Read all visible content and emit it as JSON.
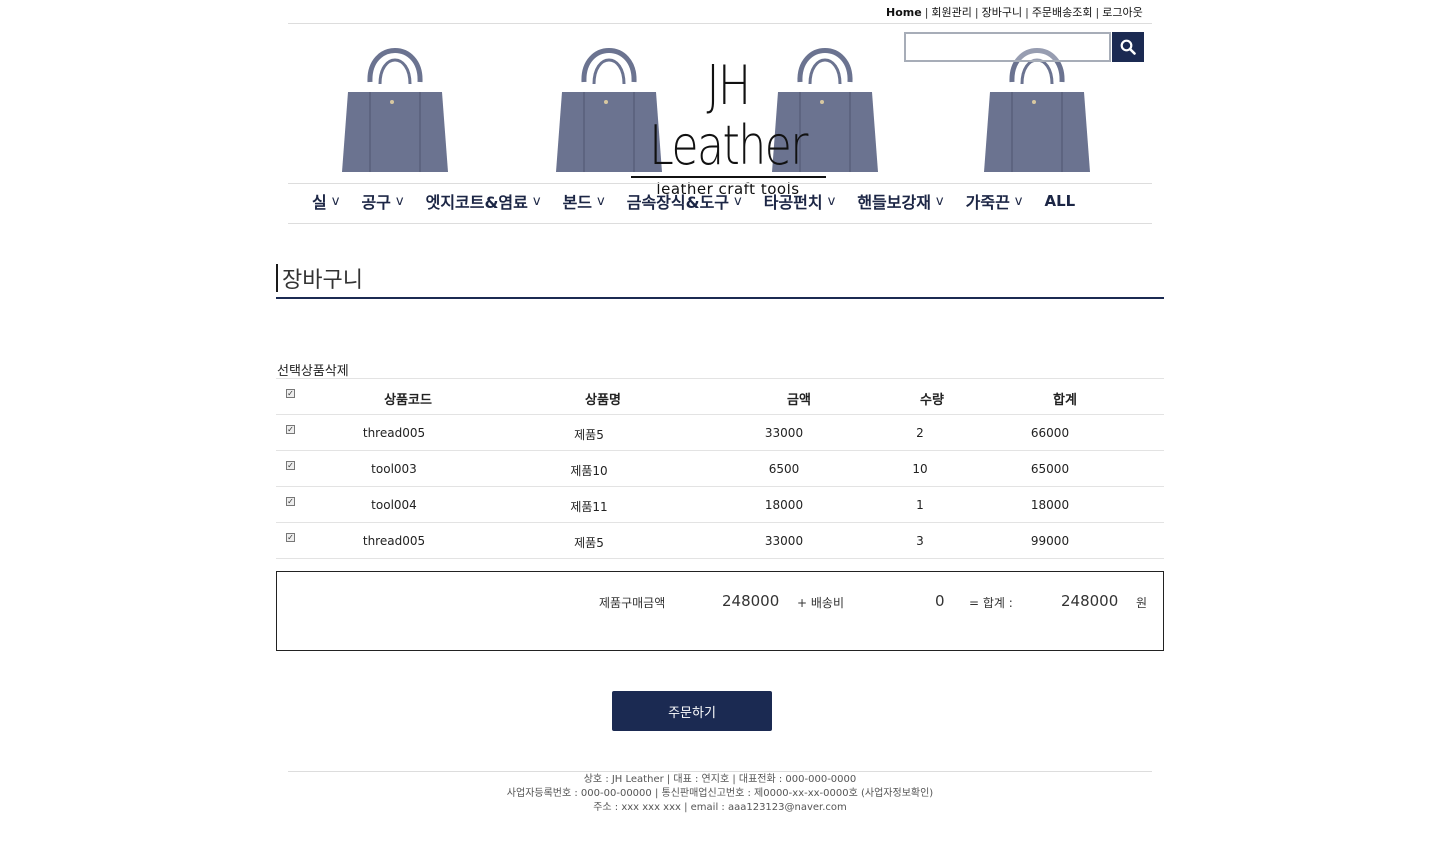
{
  "header": {
    "links": [
      "Home",
      "회원관리",
      "장바구니",
      "주문배송조회",
      "로그아웃"
    ],
    "logo_main": "JH Leather",
    "logo_sub": "leather craft tools",
    "search_value": "",
    "search_icon": "search-icon"
  },
  "nav": {
    "items": [
      "실",
      "공구",
      "엣지코트&염료",
      "본드",
      "금속장식&도구",
      "타공펀치",
      "핸들보강재",
      "가죽끈"
    ],
    "chevron": "v",
    "all_label": "ALL"
  },
  "page": {
    "title": "장바구니",
    "delete_selected": "선택상품삭제"
  },
  "cart": {
    "headers": [
      "상품코드",
      "상품명",
      "금액",
      "수량",
      "합계"
    ],
    "rows": [
      {
        "code": "thread005",
        "name": "제품5",
        "price": "33000",
        "qty": "2",
        "total": "66000"
      },
      {
        "code": "tool003",
        "name": "제품10",
        "price": "6500",
        "qty": "10",
        "total": "65000"
      },
      {
        "code": "tool004",
        "name": "제품11",
        "price": "18000",
        "qty": "1",
        "total": "18000"
      },
      {
        "code": "thread005",
        "name": "제품5",
        "price": "33000",
        "qty": "3",
        "total": "99000"
      }
    ]
  },
  "summary": {
    "purchase_label": "제품구매금액",
    "purchase_value": "248000",
    "shipping_label": "+ 배송비",
    "shipping_value": "0",
    "total_label": "= 합계 :",
    "total_value": "248000",
    "currency": "원"
  },
  "order_button": "주문하기",
  "footer": {
    "line1": "상호 : JH Leather | 대표 : 연지호 | 대표전화 : 000-000-0000",
    "line2": "사업자등록번호 : 000-00-00000 | 통신판매업신고번호 : 제0000-xx-xx-0000호 (사업자정보확인)",
    "line3": "주소 : xxx xxx xxx | email : aaa123123@naver.com"
  },
  "colors": {
    "primary": "#1b2a52",
    "bag": "#6b7390"
  }
}
